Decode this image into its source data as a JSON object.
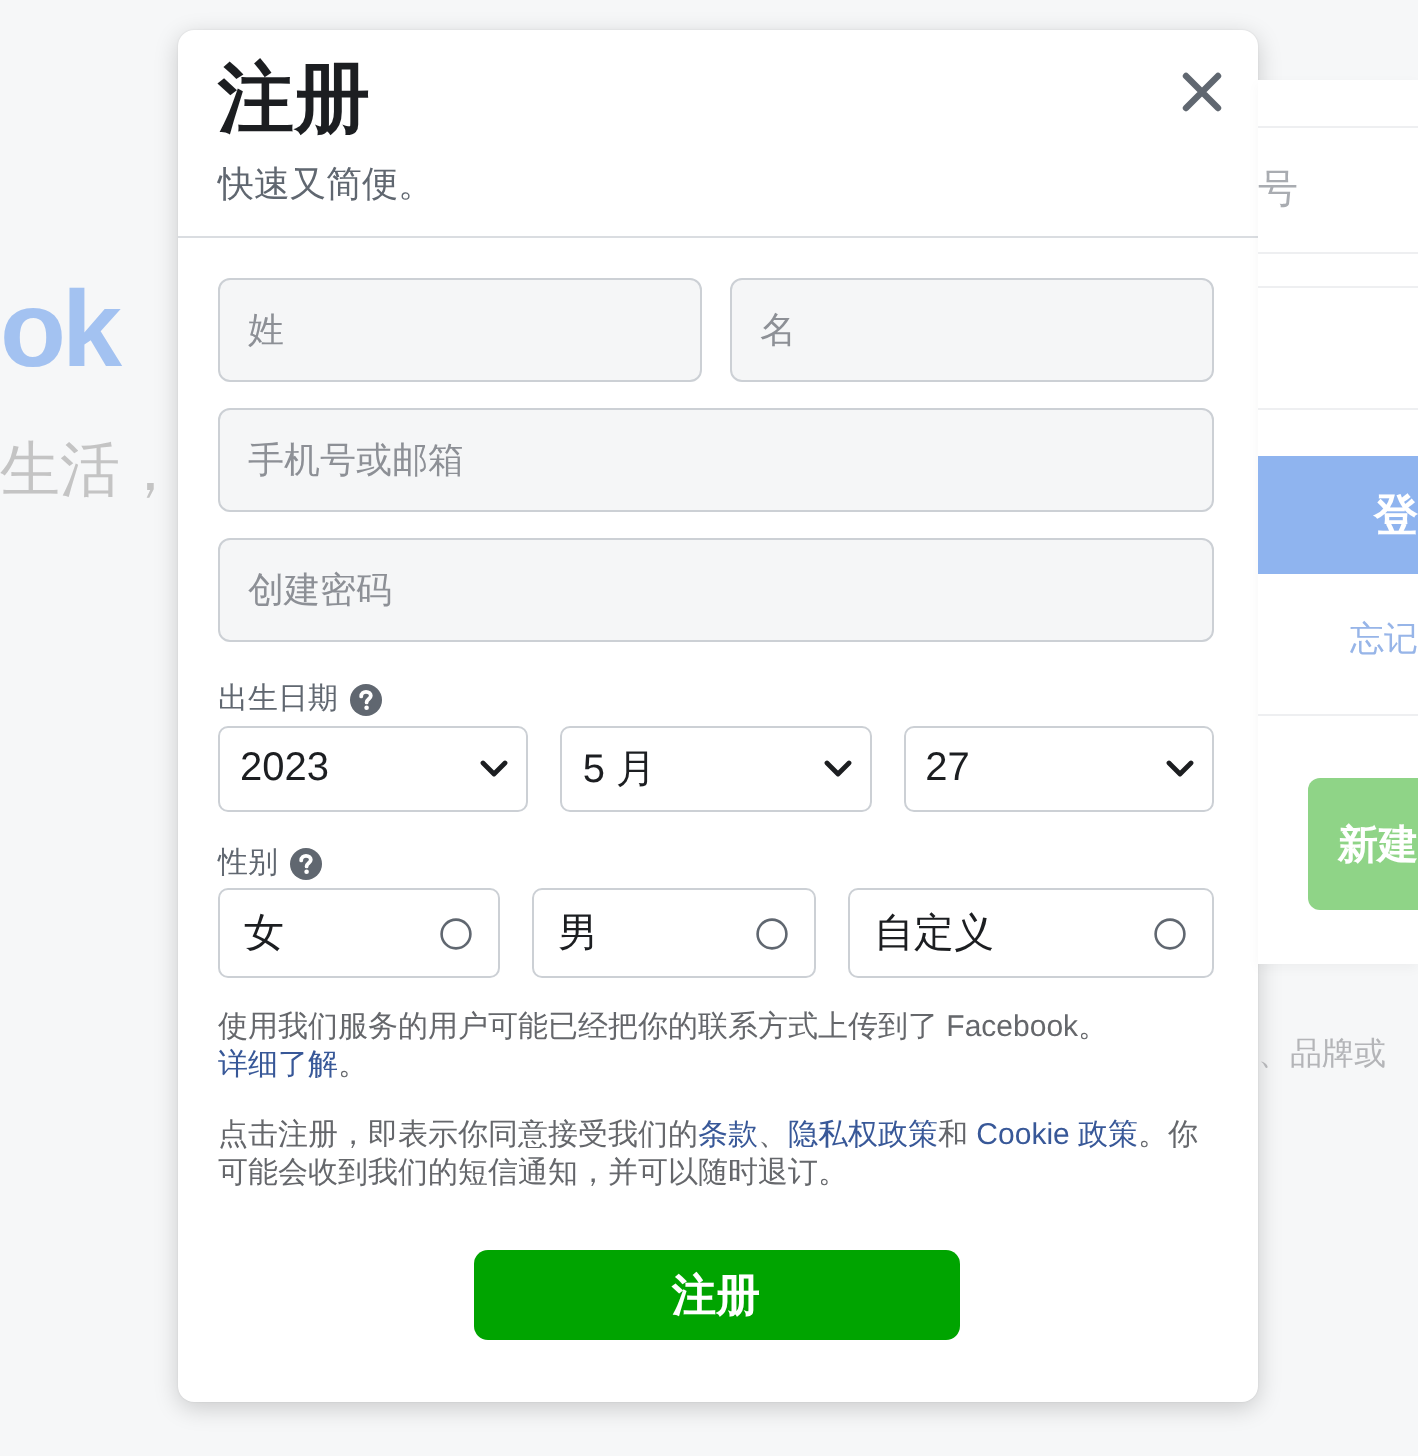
{
  "background": {
    "logo": "ok",
    "tagline": "生活，",
    "login_card": {
      "email_placeholder": "号",
      "login_button": "登",
      "forgot_link": "忘记",
      "create_button": "新建"
    },
    "footer": "、品牌或"
  },
  "dialog": {
    "title": "注册",
    "subtitle": "快速又简便。",
    "name_fields": [
      {
        "placeholder": "姓"
      },
      {
        "placeholder": "名"
      }
    ],
    "contact_field": {
      "placeholder": "手机号或邮箱"
    },
    "password_field": {
      "placeholder": "创建密码"
    },
    "birthday": {
      "label": "出生日期",
      "selects": [
        {
          "value": "2023"
        },
        {
          "value": "5 月"
        },
        {
          "value": "27"
        }
      ]
    },
    "gender": {
      "label": "性别",
      "options": [
        {
          "label": "女",
          "selected": false
        },
        {
          "label": "男",
          "selected": false
        },
        {
          "label": "自定义",
          "selected": false
        }
      ]
    },
    "notices": [
      {
        "parts": [
          {
            "kind": "text",
            "text": "使用我们服务的用户可能已经把你的联系方式上传到了 Facebook。"
          },
          {
            "kind": "link",
            "text": "详细了解"
          },
          {
            "kind": "text",
            "text": "。"
          }
        ]
      },
      {
        "parts": [
          {
            "kind": "text",
            "text": "点击注册，即表示你同意接受我们的"
          },
          {
            "kind": "link",
            "text": "条款"
          },
          {
            "kind": "text",
            "text": "、"
          },
          {
            "kind": "link",
            "text": "隐私权政策"
          },
          {
            "kind": "text",
            "text": "和 "
          },
          {
            "kind": "link",
            "text": "Cookie 政策"
          },
          {
            "kind": "text",
            "text": "。你可能会收到我们的短信通知，并可以随时退订。"
          }
        ]
      }
    ],
    "submit_button": "注册"
  }
}
